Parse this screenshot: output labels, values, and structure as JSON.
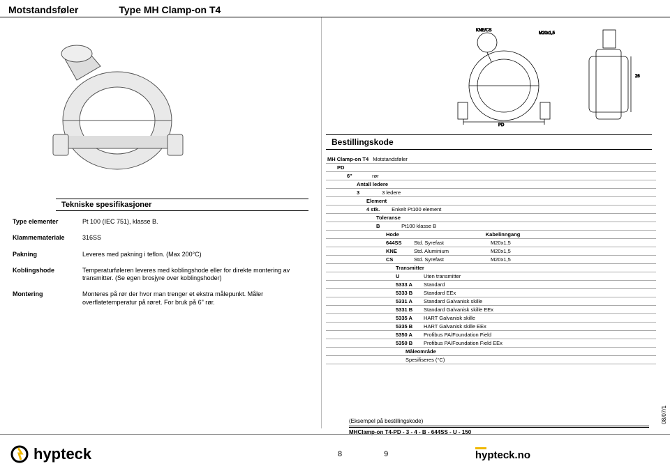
{
  "header": {
    "category": "Motstandsføler",
    "type": "Type MH Clamp-on T4"
  },
  "specs_title": "Tekniske spesifikasjoner",
  "specs": {
    "type_elementer": {
      "label": "Type elementer",
      "value": "Pt 100 (IEC 751), klasse B."
    },
    "klammemateriale": {
      "label": "Klammemateriale",
      "value": "316SS"
    },
    "pakning": {
      "label": "Pakning",
      "value": "Leveres med pakning i teflon. (Max 200°C)"
    },
    "koblingshode": {
      "label": "Koblingshode",
      "value": "Temperaturføleren leveres med koblingshode eller for direkte montering av transmitter. (Se egen brosjyre over koblingshoder)"
    },
    "montering": {
      "label": "Montering",
      "value": "Monteres på rør der hvor man trenger et ekstra målepunkt. Måler overflatetemperatur på røret. For bruk på 6\" rør."
    }
  },
  "diagram_labels": {
    "top_left": "KNE/CS",
    "top_right": "M20x1,5",
    "right": "26",
    "bottom": "PD"
  },
  "order_title": "Bestillingskode",
  "order": {
    "l0": {
      "code": "MH Clamp-on T4",
      "text": "Motstandsføler"
    },
    "l1": {
      "code": "PD",
      "text": ""
    },
    "l2": {
      "code": "6\"",
      "text": "rør"
    },
    "l3": {
      "hdr": "Antall ledere",
      "code": "3",
      "text": "3 ledere"
    },
    "l4": {
      "hdr": "Element",
      "code": "4 stk.",
      "text": "Enkelt Pt100 element"
    },
    "l5": {
      "hdr": "Toleranse",
      "code": "B",
      "text": "Pt100 klasse B"
    },
    "hode": {
      "hdr": "Hode",
      "kabel": "Kabelinngang",
      "rows": [
        {
          "c1": "644SS",
          "c2": "Std. Syrefast",
          "c3": "M20x1,5"
        },
        {
          "c1": "KNE",
          "c2": "Std. Aluminium",
          "c3": "M20x1,5"
        },
        {
          "c1": "CS",
          "c2": "Std. Syrefast",
          "c3": "M20x1,5"
        }
      ]
    },
    "transmitter": {
      "hdr": "Transmitter",
      "rows": [
        {
          "c1": "U",
          "c2": "Uten transmitter"
        },
        {
          "c1": "5333 A",
          "c2": "Standard"
        },
        {
          "c1": "5333 B",
          "c2": "Standard EEx"
        },
        {
          "c1": "5331 A",
          "c2": "Standard Galvanisk skille"
        },
        {
          "c1": "5331 B",
          "c2": "Standard Galvanisk skille EEx"
        },
        {
          "c1": "5335 A",
          "c2": "HART Galvanisk skille"
        },
        {
          "c1": "5335 B",
          "c2": "HART Galvanisk skille EEx"
        },
        {
          "c1": "5350 A",
          "c2": "Profibus PA/Foundation Field"
        },
        {
          "c1": "5350 B",
          "c2": "Profibus PA/Foundation Field EEx"
        }
      ]
    },
    "range": {
      "hdr": "Måleområde",
      "text": "Spesifiseres (°C)"
    }
  },
  "example": {
    "label": "(Eksempel på bestillingskode)",
    "code": "MHClamp-on T4-PD - 3 - 4 - B - 644SS - U - 150"
  },
  "doc_rev": "08/07/1",
  "footer": {
    "brand": "hypteck",
    "page_left": "8",
    "page_right": "9",
    "site": "hypteck.no"
  }
}
